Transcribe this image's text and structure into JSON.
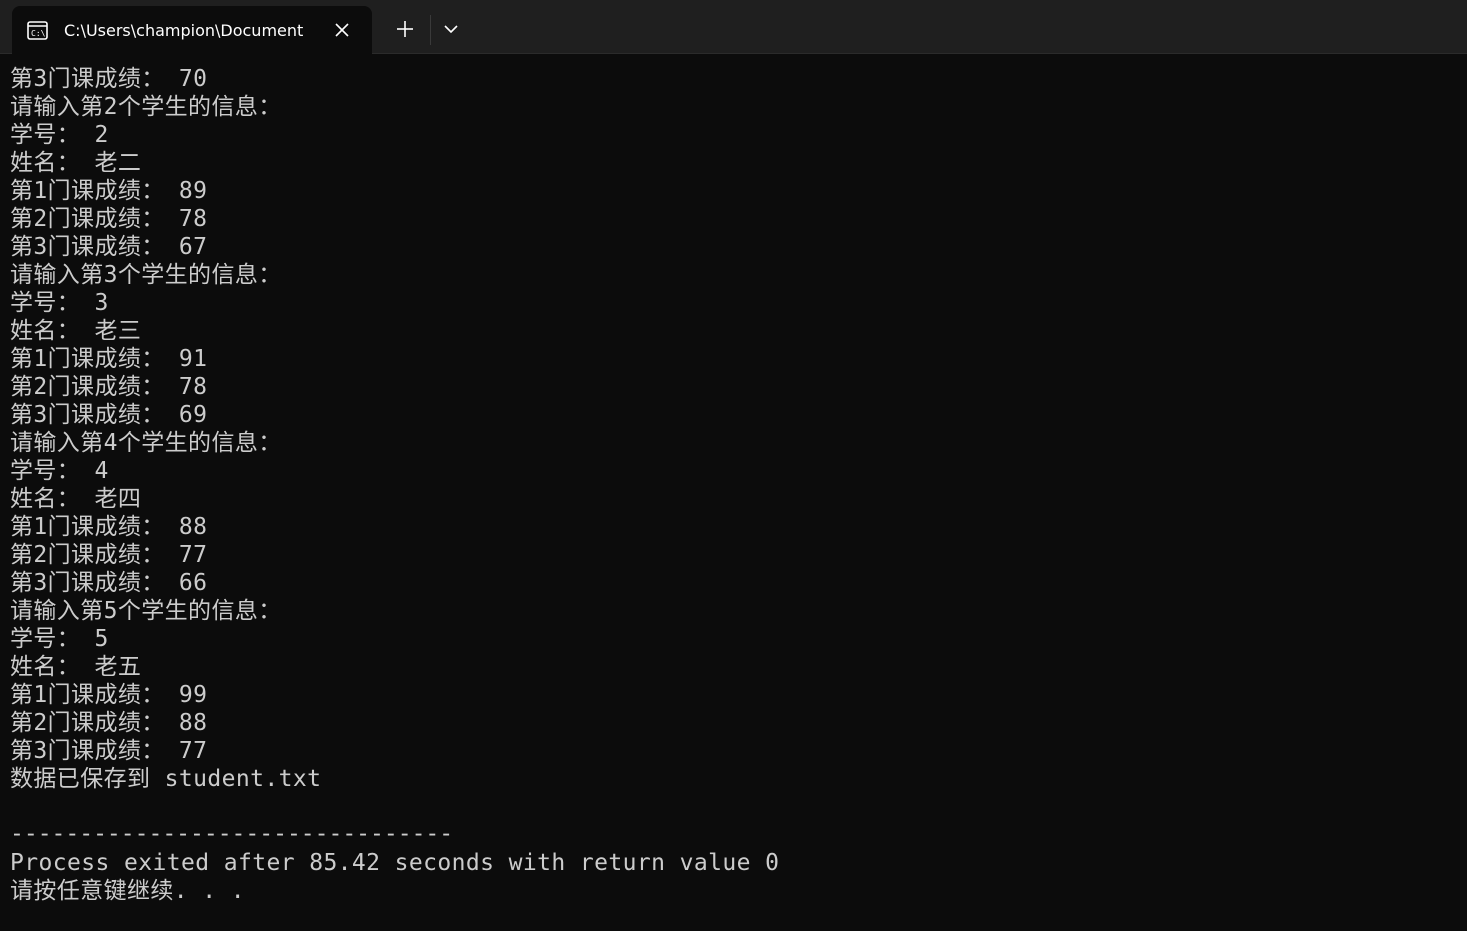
{
  "window": {
    "tab_title": "C:\\Users\\champion\\Document",
    "icons": {
      "tab": "terminal-icon",
      "close": "close-icon",
      "new_tab": "plus-icon",
      "dropdown": "chevron-down-icon"
    },
    "colors": {
      "background": "#0c0c0c",
      "tabbar": "#1f1f1f",
      "text": "#cccccc"
    }
  },
  "console": {
    "lines": [
      "第3门课成绩： 70",
      "请输入第2个学生的信息：",
      "学号： 2",
      "姓名： 老二",
      "第1门课成绩： 89",
      "第2门课成绩： 78",
      "第3门课成绩： 67",
      "请输入第3个学生的信息：",
      "学号： 3",
      "姓名： 老三",
      "第1门课成绩： 91",
      "第2门课成绩： 78",
      "第3门课成绩： 69",
      "请输入第4个学生的信息：",
      "学号： 4",
      "姓名： 老四",
      "第1门课成绩： 88",
      "第2门课成绩： 77",
      "第3门课成绩： 66",
      "请输入第5个学生的信息：",
      "学号： 5",
      "姓名： 老五",
      "第1门课成绩： 99",
      "第2门课成绩： 88",
      "第3门课成绩： 77",
      "数据已保存到 student.txt",
      "",
      "--------------------------------",
      "Process exited after 85.42 seconds with return value 0",
      "请按任意键继续. . ."
    ]
  }
}
